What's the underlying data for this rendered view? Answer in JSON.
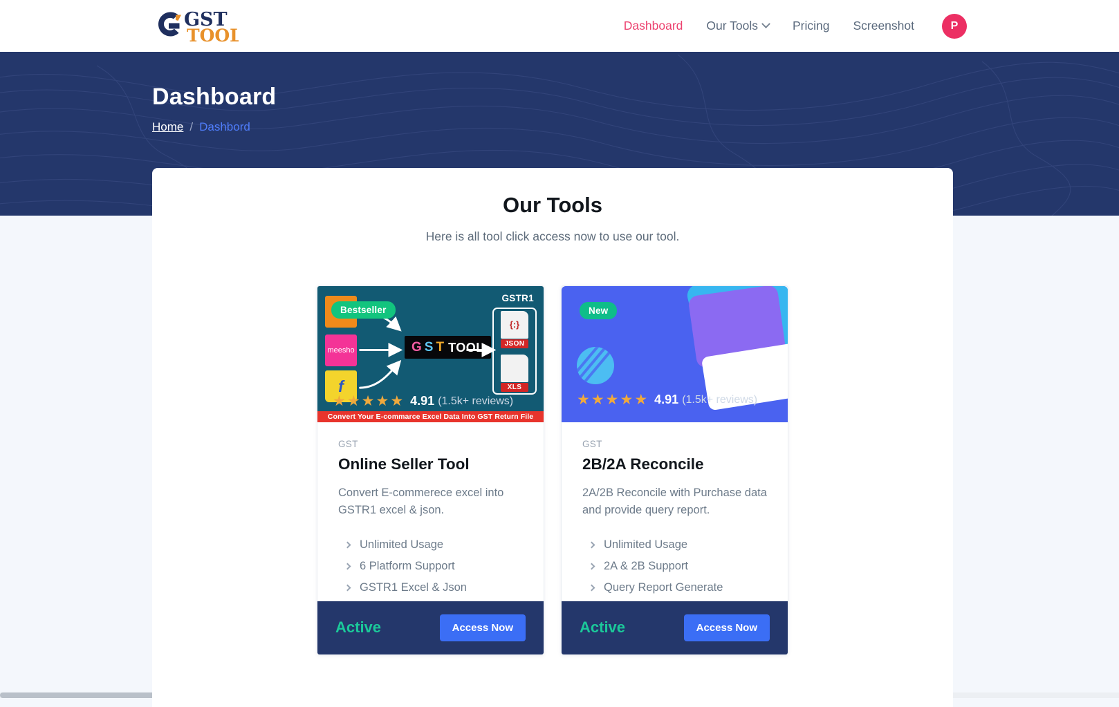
{
  "brand": {
    "name_primary": "GST",
    "name_secondary": "TOOL",
    "color_navy": "#1f2f5e",
    "color_orange": "#e8912b"
  },
  "nav": {
    "items": [
      {
        "label": "Dashboard",
        "active": true,
        "has_caret": false
      },
      {
        "label": "Our Tools",
        "active": false,
        "has_caret": true
      },
      {
        "label": "Pricing",
        "active": false,
        "has_caret": false
      },
      {
        "label": "Screenshot",
        "active": false,
        "has_caret": false
      }
    ],
    "avatar_initial": "P",
    "avatar_color": "#ec2f63",
    "active_color": "#ec4370"
  },
  "banner": {
    "title": "Dashboard",
    "breadcrumb": {
      "home": "Home",
      "separator": "/",
      "current": "Dashbord"
    },
    "bg_color": "#24376b"
  },
  "panel": {
    "title": "Our Tools",
    "subtitle": "Here is all tool click access now to use our tool."
  },
  "cards": [
    {
      "badge": "Bestseller",
      "kicker": "GST",
      "title": "Online Seller Tool",
      "description": "Convert E-commerece excel into GSTR1 excel & json.",
      "features": [
        "Unlimited Usage",
        "6 Platform Support",
        "GSTR1 Excel & Json"
      ],
      "rating": "4.91",
      "reviews": "(1.5k+ reviews)",
      "stars": 5,
      "status": "Active",
      "cta": "Access Now",
      "art": {
        "gstr_label": "GSTR1",
        "logo_g": "G",
        "logo_s": "S",
        "logo_t": "T",
        "logo_tool": "TOOL",
        "platform_meesho": "meesho",
        "platform_flipkart": "f",
        "file_json_glyph": "{:}",
        "file_json_tag": "JSON",
        "file_xls_tag": "XLS",
        "ribbon": "Convert Your E-commarce Excel Data Into GST Return File"
      }
    },
    {
      "badge": "New",
      "kicker": "GST",
      "title": "2B/2A Reconcile",
      "description": "2A/2B Reconcile with Purchase data and provide query report.",
      "features": [
        "Unlimited Usage",
        "2A & 2B Support",
        "Query Report Generate"
      ],
      "rating": "4.91",
      "reviews": "(1.5k+ reviews)",
      "stars": 5,
      "status": "Active",
      "cta": "Access Now"
    }
  ]
}
